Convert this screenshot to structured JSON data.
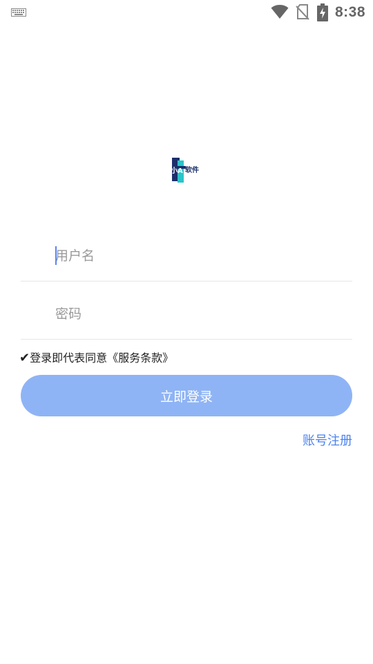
{
  "status_bar": {
    "time": "8:38",
    "icons": [
      "keyboard-icon",
      "wifi-icon",
      "no-sim-icon",
      "battery-charging-icon"
    ]
  },
  "logo": {
    "text": "小A软件",
    "icon": "app-logo"
  },
  "form": {
    "username_placeholder": "用户名",
    "username_value": "",
    "password_placeholder": "密码",
    "password_value": ""
  },
  "terms": {
    "check": "✔",
    "text": "登录即代表同意《服务条款》"
  },
  "actions": {
    "login_label": "立即登录",
    "register_label": "账号注册"
  },
  "colors": {
    "primary": "#8fb4f5",
    "link": "#4a82ef",
    "placeholder": "#9a9a9a",
    "divider": "#e6e6e6"
  }
}
